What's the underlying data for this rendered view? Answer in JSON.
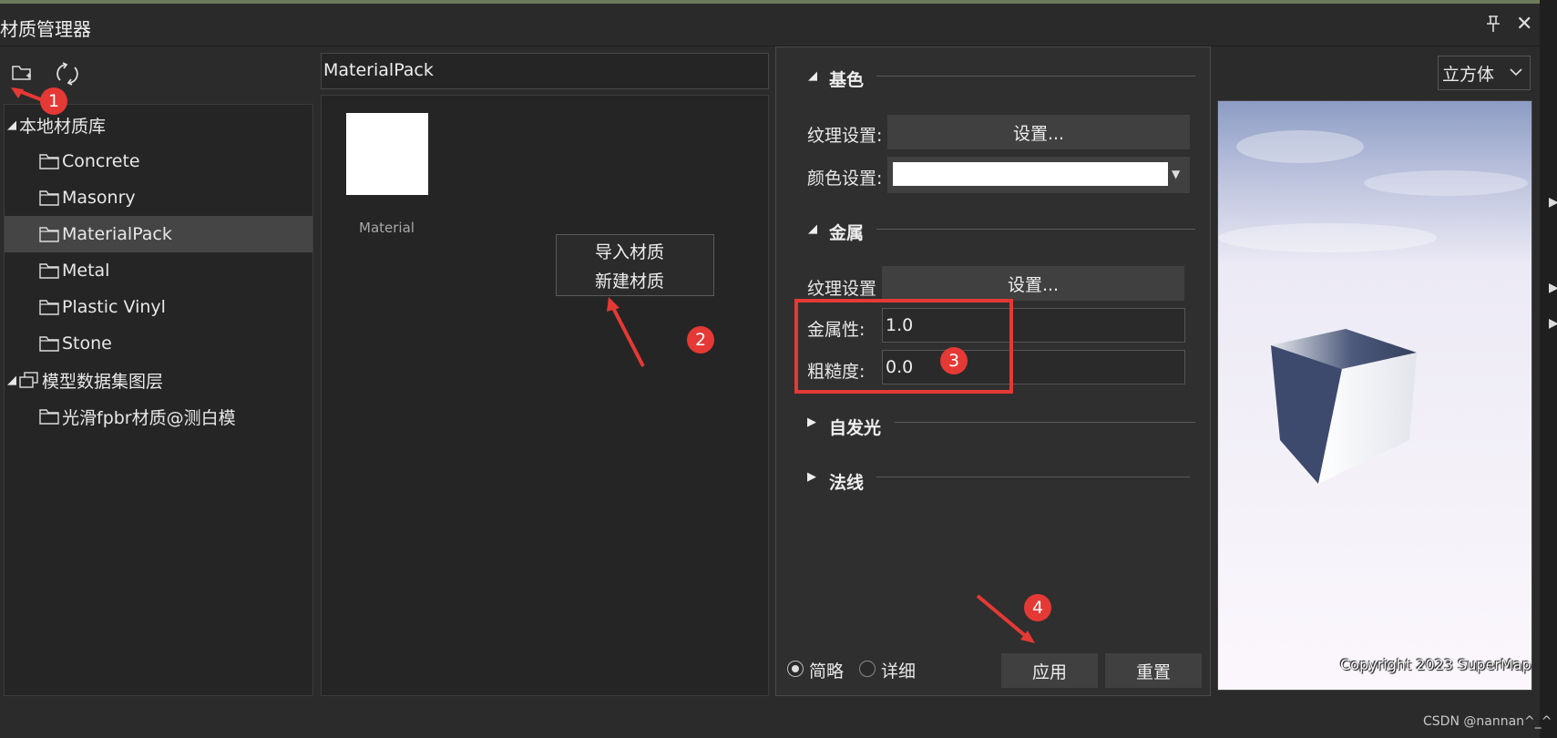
{
  "window": {
    "title": "材质管理器",
    "pin_icon": "pin-icon",
    "close_icon": "close-icon"
  },
  "toolbar": {
    "icons": [
      "folder-add-icon",
      "refresh-icon"
    ]
  },
  "tree": {
    "root1": "本地材质库",
    "items": [
      "Concrete",
      "Masonry",
      "MaterialPack",
      "Metal",
      "Plastic Vinyl",
      "Stone"
    ],
    "selected": "MaterialPack",
    "root2": "模型数据集图层",
    "sub_item": "光滑fpbr材质@测白模"
  },
  "path": "MaterialPack",
  "material": {
    "label": "Material",
    "thumb_color": "#ffffff"
  },
  "context_menu": {
    "items": [
      "导入材质",
      "新建材质"
    ]
  },
  "props": {
    "base": {
      "title": "基色",
      "texture_label": "纹理设置:",
      "texture_button": "设置...",
      "color_label": "颜色设置:",
      "color_value": "#ffffff"
    },
    "metal": {
      "title": "金属",
      "texture_label": "纹理设置",
      "texture_button": "设置...",
      "metallic_label": "金属性:",
      "metallic_value": "1.0",
      "roughness_label": "粗糙度:",
      "roughness_value": "0.0"
    },
    "emission": {
      "title": "自发光"
    },
    "normal": {
      "title": "法线"
    },
    "mode": {
      "simple": "简略",
      "detailed": "详细",
      "selected": "简略"
    },
    "apply": "应用",
    "reset": "重置"
  },
  "preview": {
    "shape": "立方体",
    "copyright": "Copyright 2023 SuperMap"
  },
  "annotations": [
    "1",
    "2",
    "3",
    "4"
  ],
  "accent_red": "#e53935",
  "watermark": "CSDN @nannan^_^"
}
